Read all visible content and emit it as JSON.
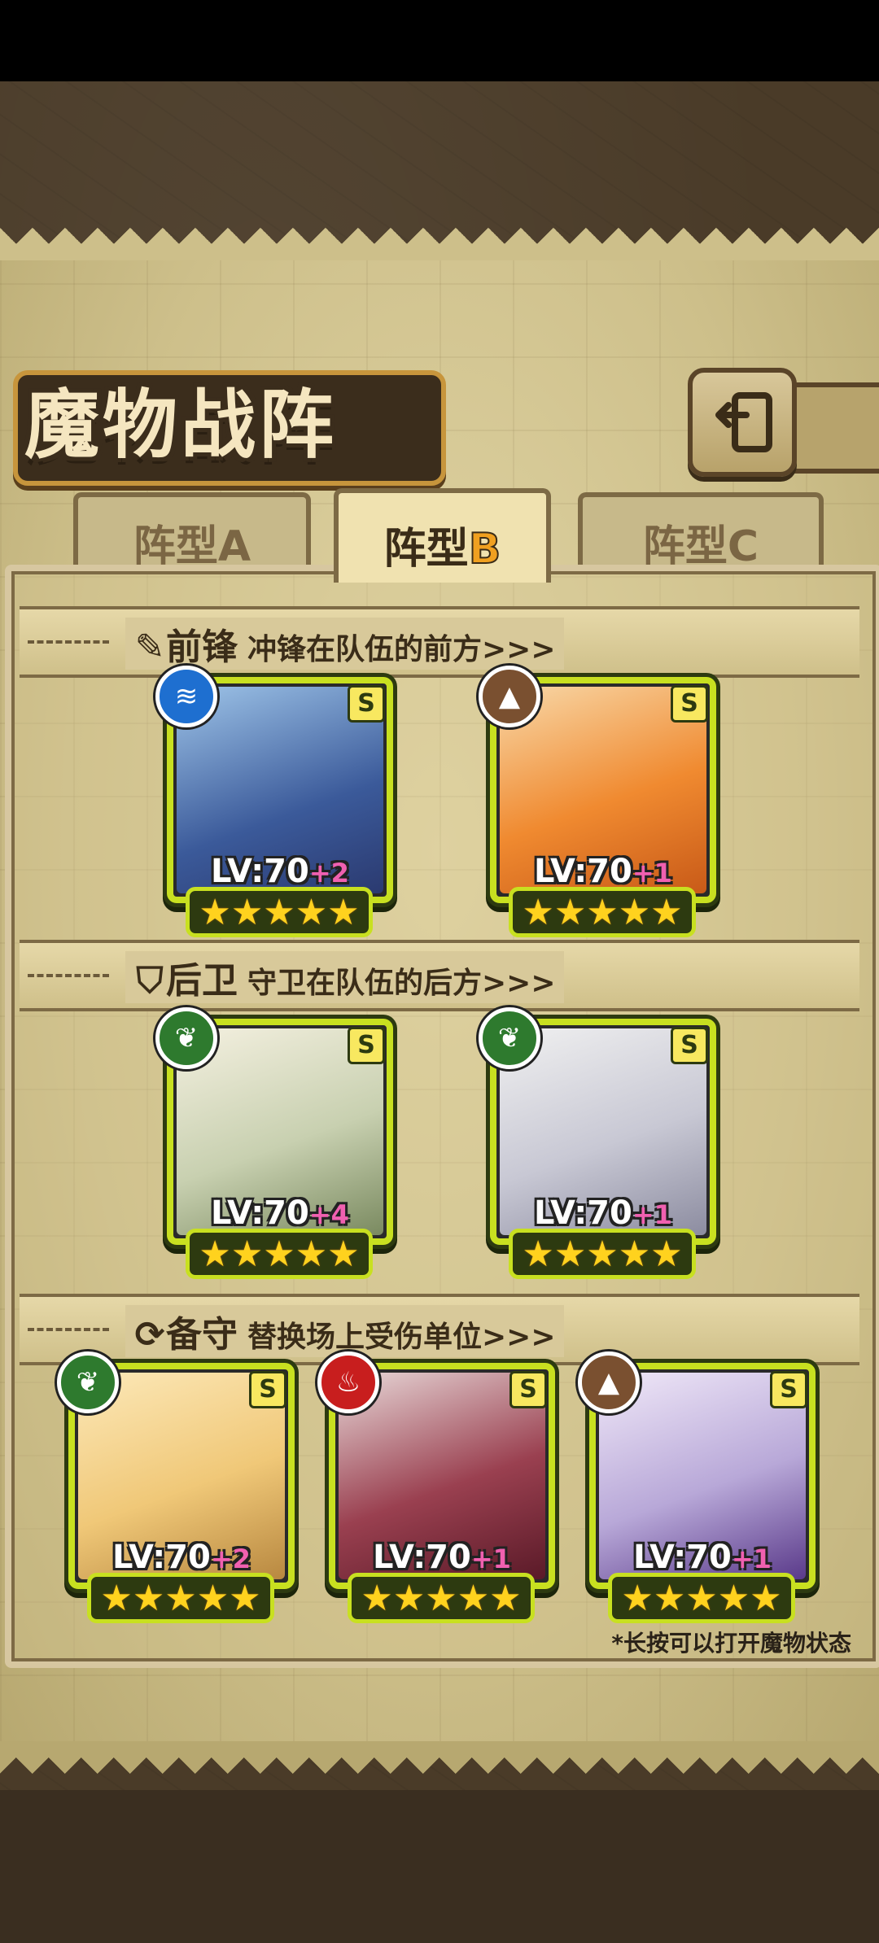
{
  "title": "魔物战阵",
  "tabs": {
    "a": {
      "label": "阵型A"
    },
    "b": {
      "label_prefix": "阵型",
      "label_letter": "B"
    },
    "c": {
      "label": "阵型C"
    }
  },
  "sections": [
    {
      "title": "前锋",
      "subtitle": "冲锋在队伍的前方>>>",
      "icon": "sword-icon"
    },
    {
      "title": "后卫",
      "subtitle": "守卫在队伍的后方>>>",
      "icon": "shield-icon"
    },
    {
      "title": "备守",
      "subtitle": "替换场上受伤单位>>>",
      "icon": "swap-icon"
    }
  ],
  "cards": [
    {
      "lv": "LV:70",
      "plus": "+2",
      "rank": "S",
      "element": "water",
      "stars": "★★★★★"
    },
    {
      "lv": "LV:70",
      "plus": "+1",
      "rank": "S",
      "element": "earth",
      "stars": "★★★★★"
    },
    {
      "lv": "LV:70",
      "plus": "+4",
      "rank": "S",
      "element": "nature",
      "stars": "★★★★★"
    },
    {
      "lv": "LV:70",
      "plus": "+1",
      "rank": "S",
      "element": "nature",
      "stars": "★★★★★"
    },
    {
      "lv": "LV:70",
      "plus": "+2",
      "rank": "S",
      "element": "nature",
      "stars": "★★★★★"
    },
    {
      "lv": "LV:70",
      "plus": "+1",
      "rank": "S",
      "element": "fire",
      "stars": "★★★★★"
    },
    {
      "lv": "LV:70",
      "plus": "+1",
      "rank": "S",
      "element": "earth",
      "stars": "★★★★★"
    }
  ],
  "footnote": "*长按可以打开魔物状态",
  "colors": {
    "card_border": "#c8e020",
    "star": "#ffd21e",
    "plus": "#f060b0",
    "accent_b": "#f0a020"
  }
}
